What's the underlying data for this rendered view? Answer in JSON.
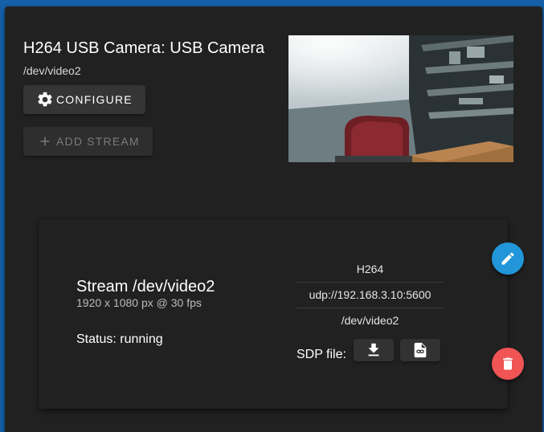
{
  "camera": {
    "title": "H264 USB Camera: USB Camera",
    "device": "/dev/video2",
    "configure_label": "CONFIGURE",
    "add_stream_label": "ADD STREAM"
  },
  "stream": {
    "title": "Stream /dev/video2",
    "resolution": "1920 x 1080 px @ 30 fps",
    "status": "Status: running",
    "info": [
      "H264",
      "udp://192.168.3.10:5600",
      "/dev/video2"
    ],
    "sdp_label": "SDP file:"
  },
  "icons": {
    "configure": "gear-icon",
    "add_stream": "plus-icon",
    "download_sdp": "download-icon",
    "link_sdp": "file-link-icon",
    "edit": "pencil-icon",
    "delete": "trash-icon"
  },
  "colors": {
    "page_bg": "#1560a8",
    "card_bg": "#212121",
    "edit_fab": "#2196d8",
    "delete_fab": "#f05454"
  }
}
